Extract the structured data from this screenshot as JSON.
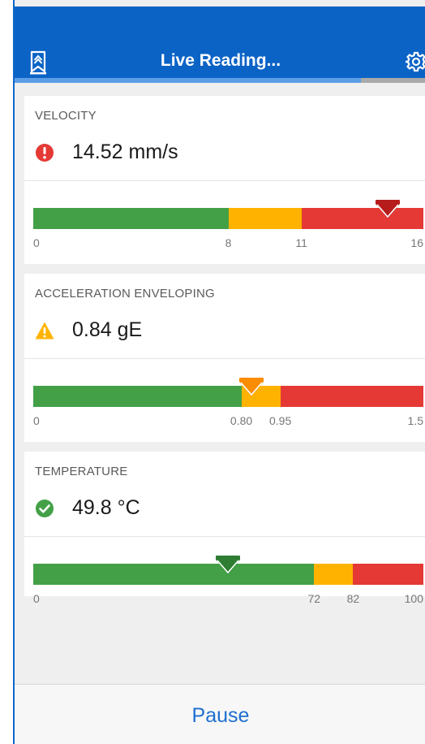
{
  "header": {
    "title": "Live Reading...",
    "left_icon": "bookmark-icon",
    "right_icon": "gear-icon",
    "progress": 0.84
  },
  "colors": {
    "header": "#0b63c6",
    "green": "#43a047",
    "amber": "#ffb300",
    "red": "#e53935",
    "marker_red": "#b71c1c",
    "marker_orange": "#fb8c00",
    "marker_green": "#2e7d32",
    "accent": "#1d6fd0"
  },
  "cards": [
    {
      "label": "VELOCITY",
      "status": "alarm",
      "status_icon": "alert-circle-icon",
      "value": "14.52 mm/s",
      "gauge": {
        "min": 0,
        "warn": 8,
        "alarm": 11,
        "max": 16,
        "reading": 14.52,
        "ticks": [
          "0",
          "8",
          "11",
          "16"
        ]
      }
    },
    {
      "label": "ACCELERATION ENVELOPING",
      "status": "warning",
      "status_icon": "warning-triangle-icon",
      "value": "0.84 gE",
      "gauge": {
        "min": 0,
        "warn": 0.8,
        "alarm": 0.95,
        "max": 1.5,
        "reading": 0.84,
        "ticks": [
          "0",
          "0.80",
          "0.95",
          "1.5"
        ]
      }
    },
    {
      "label": "TEMPERATURE",
      "status": "ok",
      "status_icon": "check-circle-icon",
      "value": "49.8 °C",
      "gauge": {
        "min": 0,
        "warn": 72,
        "alarm": 82,
        "max": 100,
        "reading": 49.8,
        "ticks": [
          "0",
          "72",
          "82",
          "100"
        ]
      }
    }
  ],
  "footer": {
    "button_label": "Pause"
  }
}
